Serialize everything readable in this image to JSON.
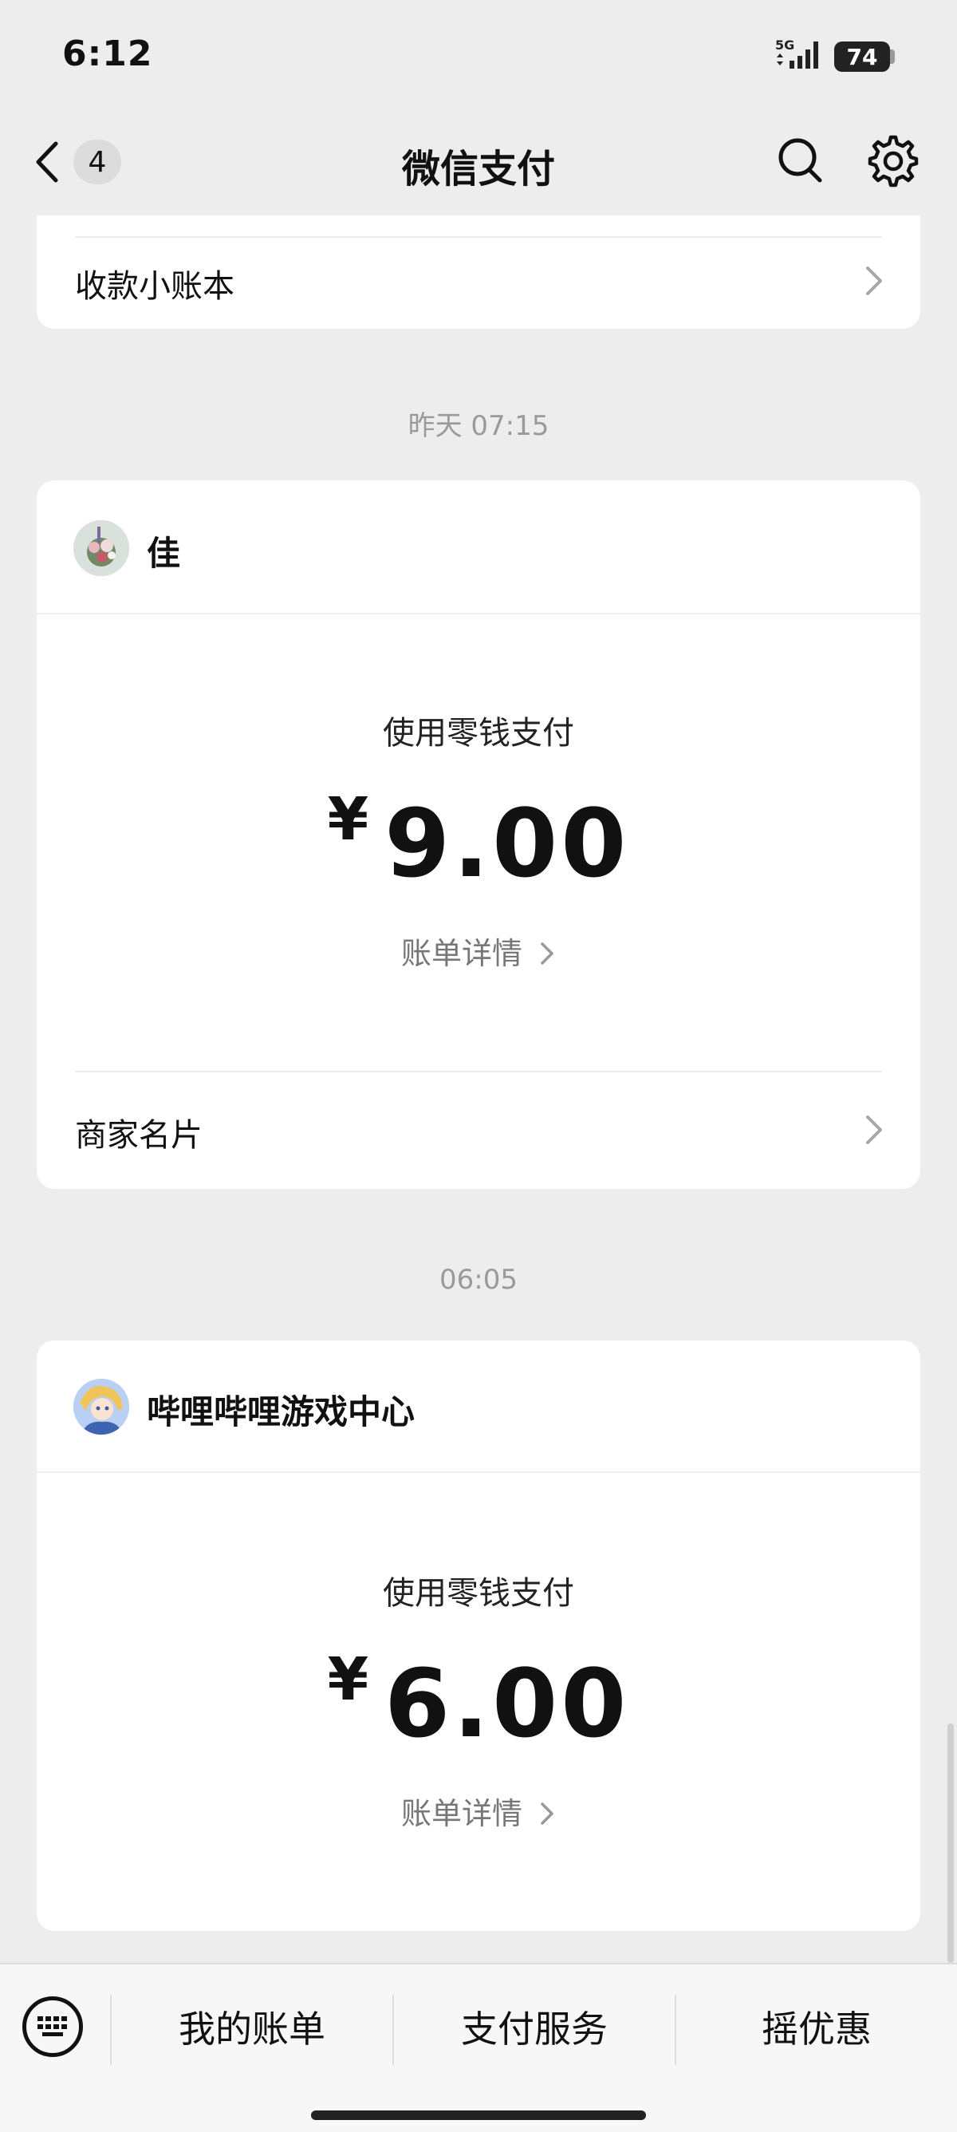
{
  "status_bar": {
    "time": "6:12",
    "network": "5G",
    "battery": "74"
  },
  "nav": {
    "back_badge": "4",
    "title": "微信支付"
  },
  "card_top": {
    "label": "收款小账本"
  },
  "messages": [
    {
      "time": "昨天 07:15",
      "merchant": "佳",
      "pay_method": "使用零钱支付",
      "currency": "¥",
      "amount": "9.00",
      "detail_link": "账单详情",
      "footer_label": "商家名片"
    },
    {
      "time": "06:05",
      "merchant": "哔哩哔哩游戏中心",
      "pay_method": "使用零钱支付",
      "currency": "¥",
      "amount": "6.00",
      "detail_link": "账单详情"
    }
  ],
  "bottom_bar": {
    "items": [
      "我的账单",
      "支付服务",
      "摇优惠"
    ]
  },
  "icons": {
    "back": "chevron-left-icon",
    "search": "search-icon",
    "settings": "gear-icon",
    "keyboard": "keyboard-icon",
    "chevron": "chevron-right-icon"
  }
}
